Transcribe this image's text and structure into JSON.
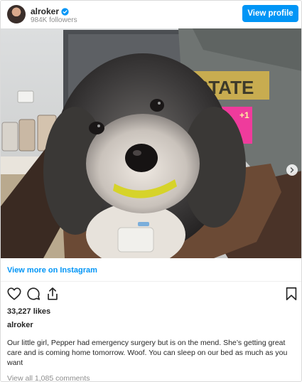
{
  "header": {
    "username": "alroker",
    "followers": "984K followers",
    "view_profile_label": "View profile",
    "verified_icon": "verified-badge-icon"
  },
  "photo": {
    "next_icon": "chevron-right-icon",
    "print_text": [
      "STATE",
      "+1"
    ]
  },
  "links": {
    "view_more": "View more on Instagram"
  },
  "actions": {
    "icons": [
      "heart-icon",
      "comment-icon",
      "share-icon",
      "bookmark-icon"
    ]
  },
  "post": {
    "likes": "33,227 likes",
    "author": "alroker",
    "caption": "Our little girl, Pepper had emergency surgery but is on the mend. She’s getting great care and is coming home tomorrow. Woof. You can sleep on our bed as much as you want",
    "comments_link": "View all 1,085 comments"
  },
  "colors": {
    "accent": "#0095f6",
    "muted": "#8e8e8e",
    "text": "#262626",
    "border": "#dbdbdb"
  }
}
